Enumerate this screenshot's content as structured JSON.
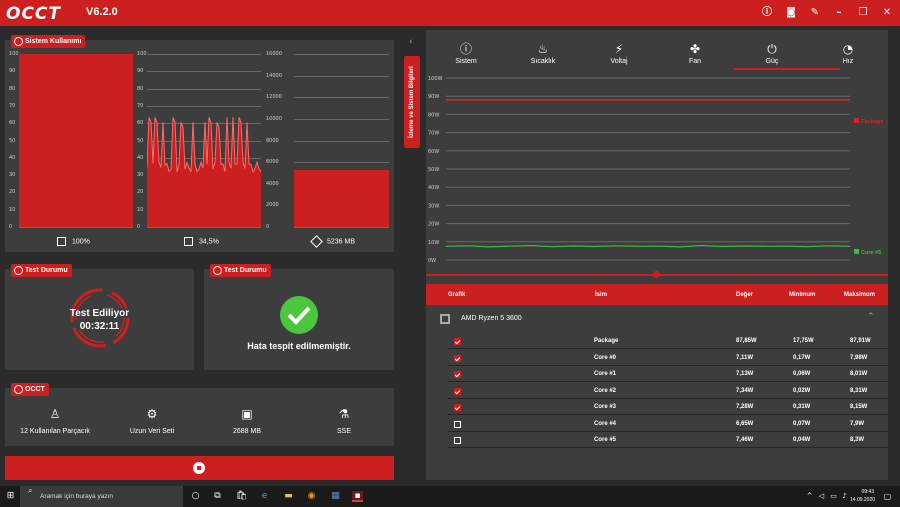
{
  "app": {
    "logo": "OCCT",
    "version": "V6.2.0"
  },
  "titlebar_icons": [
    "info-icon",
    "camera-icon",
    "wrench-icon",
    "minimize-icon",
    "restore-icon",
    "close-icon"
  ],
  "system_usage": {
    "tag": "Sistem Kullanımı",
    "charts": [
      {
        "ticks": [
          "100",
          "90",
          "80",
          "70",
          "60",
          "50",
          "40",
          "30",
          "20",
          "10",
          "0"
        ],
        "value_pct": 100
      },
      {
        "ticks": [
          "100",
          "90",
          "80",
          "70",
          "60",
          "50",
          "40",
          "30",
          "20",
          "10",
          "0"
        ],
        "value_pct": 34.5
      },
      {
        "ticks": [
          "16000",
          "14000",
          "12000",
          "10000",
          "8000",
          "6000",
          "4000",
          "2000",
          "0"
        ],
        "value_mb": 5236
      }
    ],
    "stats": [
      {
        "icon": "cpu-icon",
        "label": "100%"
      },
      {
        "icon": "ram-icon",
        "label": "34,5%"
      },
      {
        "icon": "memory-icon",
        "label": "5236 MB"
      }
    ]
  },
  "test_status_1": {
    "tag": "Test Durumu",
    "title": "Test Ediliyor",
    "elapsed": "00:32:11"
  },
  "test_status_2": {
    "tag": "Test Durumu",
    "message": "Hata tespit edilmemiştir."
  },
  "occt_card": {
    "tag": "OCCT",
    "items": [
      {
        "icon": "user-icon",
        "label": "12 Kullanılan Parçacık"
      },
      {
        "icon": "gears-icon",
        "label": "Uzun Veri Seti"
      },
      {
        "icon": "chip-icon",
        "label": "2688 MB"
      },
      {
        "icon": "flask-icon",
        "label": "SSE"
      }
    ]
  },
  "side_tab": {
    "label": "İzleme ve Sistem Bilgileri"
  },
  "monitor_tabs": [
    {
      "icon": "info-icon",
      "label": "Sistem"
    },
    {
      "icon": "thermometer-icon",
      "label": "Sıcaklık"
    },
    {
      "icon": "plug-icon",
      "label": "Voltaj"
    },
    {
      "icon": "fan-icon",
      "label": "Fan"
    },
    {
      "icon": "power-plug-icon",
      "label": "Güç",
      "active": true
    },
    {
      "icon": "speed-icon",
      "label": "Hız"
    }
  ],
  "power_chart": {
    "yticks": [
      "100W",
      "90W",
      "80W",
      "70W",
      "60W",
      "50W",
      "40W",
      "30W",
      "20W",
      "10W",
      "0W"
    ],
    "package_label": "Package",
    "core_label": "Core #5"
  },
  "chart_data": {
    "type": "line",
    "ylim": [
      0,
      100
    ],
    "series": [
      {
        "name": "Package",
        "color": "#e02020",
        "values": [
          88,
          88,
          88,
          88,
          88,
          88,
          88,
          88,
          88,
          88,
          88,
          88,
          88,
          88,
          88,
          88,
          88,
          88,
          88,
          88
        ]
      },
      {
        "name": "Core #5",
        "color": "#3cbe3c",
        "values": [
          7.5,
          7.8,
          7.2,
          7.6,
          7.9,
          7.3,
          7.7,
          7.4,
          7.8,
          7.5,
          7.6,
          7.2,
          7.9,
          7.4,
          7.7,
          7.5,
          7.6,
          7.3,
          7.8,
          7.5
        ]
      }
    ]
  },
  "table": {
    "headers": {
      "graph": "Grafik",
      "name": "İsim",
      "value": "Değer",
      "min": "Minimum",
      "max": "Maksimum"
    },
    "group": {
      "name": "AMD Ryzen 5 3600"
    },
    "rows": [
      {
        "checked": true,
        "name": "Package",
        "value": "87,85W",
        "min": "17,75W",
        "max": "87,91W"
      },
      {
        "checked": true,
        "name": "Core #0",
        "value": "7,11W",
        "min": "0,17W",
        "max": "7,98W"
      },
      {
        "checked": true,
        "name": "Core #1",
        "value": "7,13W",
        "min": "0,06W",
        "max": "8,01W"
      },
      {
        "checked": true,
        "name": "Core #2",
        "value": "7,34W",
        "min": "0,02W",
        "max": "8,31W"
      },
      {
        "checked": true,
        "name": "Core #3",
        "value": "7,28W",
        "min": "0,31W",
        "max": "8,15W"
      },
      {
        "checked": false,
        "name": "Core #4",
        "value": "6,65W",
        "min": "0,07W",
        "max": "7,9W"
      },
      {
        "checked": false,
        "name": "Core #5",
        "value": "7,46W",
        "min": "0,04W",
        "max": "8,3W"
      }
    ]
  },
  "taskbar": {
    "search_placeholder": "Aramak için buraya yazın",
    "time": "09:43",
    "date": "14.09.2020"
  }
}
